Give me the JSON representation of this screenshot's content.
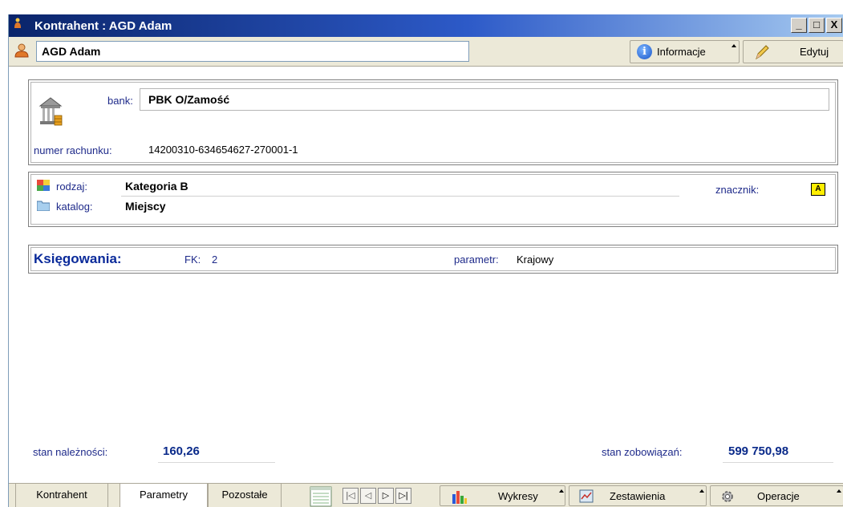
{
  "window": {
    "title": "Kontrahent : AGD Adam",
    "buttons": [
      "_",
      "□",
      "X"
    ]
  },
  "header": {
    "name": "AGD Adam",
    "info_button": "Informacje",
    "edit_button": "Edytuj"
  },
  "bank": {
    "bank_label": "bank:",
    "bank_value": "PBK O/Zamość",
    "account_label": "numer rachunku:",
    "account_value": "14200310-634654627-270001-1"
  },
  "category": {
    "rodzaj_label": "rodzaj:",
    "rodzaj_value": "Kategoria B",
    "katalog_label": "katalog:",
    "katalog_value": "Miejscy",
    "znacznik_label": "znacznik:",
    "znacznik_value": "A"
  },
  "ksiegowania": {
    "title": "Księgowania:",
    "fk_label": "FK:",
    "fk_value": "2",
    "param_label": "parametr:",
    "param_value": "Krajowy"
  },
  "summary": {
    "naleznosci_label": "stan należności:",
    "naleznosci_value": "160,26",
    "zobowiazan_label": "stan zobowiązań:",
    "zobowiazan_value": "599 750,98"
  },
  "bottom": {
    "tabs": [
      "Kontrahent",
      "Parametry",
      "Pozostałe"
    ],
    "active_tab": "Parametry",
    "nav": [
      "|◁",
      "◁",
      "▷",
      "▷|"
    ],
    "wykresy": "Wykresy",
    "zestawienia": "Zestawienia",
    "operacje": "Operacje"
  }
}
